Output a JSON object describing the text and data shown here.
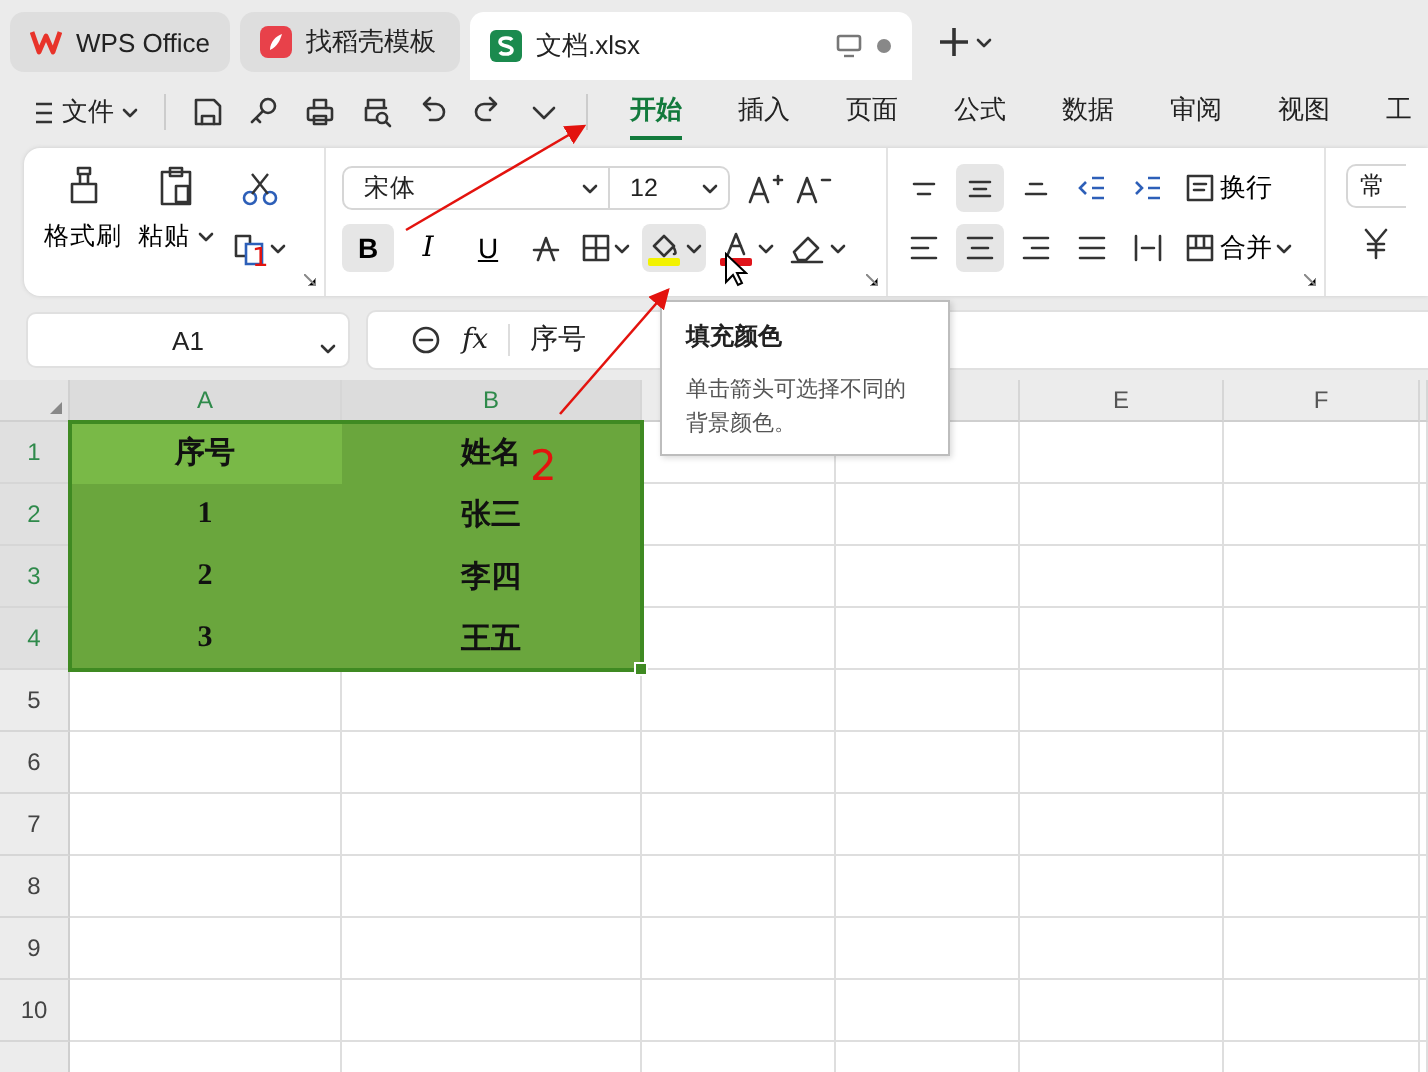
{
  "tabs": [
    {
      "label": "WPS Office",
      "kind": "wps",
      "selected": false
    },
    {
      "label": "找稻壳模板",
      "kind": "docer",
      "selected": false
    },
    {
      "label": "文档.xlsx",
      "kind": "sheet",
      "selected": true
    }
  ],
  "menu": {
    "file": "文件",
    "tabs": [
      {
        "label": "开始",
        "selected": true
      },
      {
        "label": "插入",
        "selected": false
      },
      {
        "label": "页面",
        "selected": false
      },
      {
        "label": "公式",
        "selected": false
      },
      {
        "label": "数据",
        "selected": false
      },
      {
        "label": "审阅",
        "selected": false
      },
      {
        "label": "视图",
        "selected": false
      },
      {
        "label": "工",
        "selected": false
      }
    ]
  },
  "ribbon": {
    "format_painter": "格式刷",
    "paste": "粘贴",
    "font": "宋体",
    "font_size": "12",
    "font_buttons": [
      {
        "label": "B",
        "kind": "bold",
        "selected": true
      },
      {
        "label": "I",
        "kind": "italic",
        "selected": false
      },
      {
        "label": "U",
        "kind": "underline",
        "selected": false
      }
    ],
    "fill_selected": true,
    "align_top": [
      {
        "kind": "top",
        "selected": false
      },
      {
        "kind": "middle",
        "selected": true
      },
      {
        "kind": "bottom",
        "selected": false
      }
    ],
    "align_row": [
      {
        "kind": "left",
        "selected": false
      },
      {
        "kind": "center",
        "selected": true
      },
      {
        "kind": "right",
        "selected": false
      },
      {
        "kind": "justify",
        "selected": false
      }
    ],
    "wrap": "换行",
    "merge": "合并",
    "number_format": "常"
  },
  "formula_bar": {
    "cell": "A1",
    "fx": "fx",
    "content": "序号"
  },
  "tooltip": {
    "title": "填充颜色",
    "text": "单击箭头可选择不同的背景颜色。"
  },
  "sheet": {
    "columns": [
      {
        "label": "A",
        "selected": true
      },
      {
        "label": "B",
        "selected": true
      },
      {
        "selected": false
      },
      {
        "selected": false
      },
      {
        "label": "E",
        "selected": false
      },
      {
        "label": "F",
        "selected": false
      }
    ],
    "rows": [
      {
        "label": "1",
        "filled": true,
        "cells": [
          {
            "text": "序号",
            "active": true
          },
          {
            "text": "姓名",
            "active": false
          }
        ]
      },
      {
        "label": "2",
        "filled": true,
        "cells": [
          {
            "text": "1",
            "active": false
          },
          {
            "text": "张三",
            "active": false
          }
        ]
      },
      {
        "label": "3",
        "filled": true,
        "cells": [
          {
            "text": "2",
            "active": false
          },
          {
            "text": "李四",
            "active": false
          }
        ]
      },
      {
        "label": "4",
        "filled": true,
        "cells": [
          {
            "text": "3",
            "active": false
          },
          {
            "text": "王五",
            "active": false
          }
        ]
      },
      {
        "label": "5",
        "filled": false
      },
      {
        "label": "6",
        "filled": false
      },
      {
        "label": "7",
        "filled": false
      },
      {
        "label": "8",
        "filled": false
      },
      {
        "label": "9",
        "filled": false
      },
      {
        "label": "10",
        "filled": false
      }
    ]
  },
  "annotations": [
    "1",
    "2"
  ]
}
